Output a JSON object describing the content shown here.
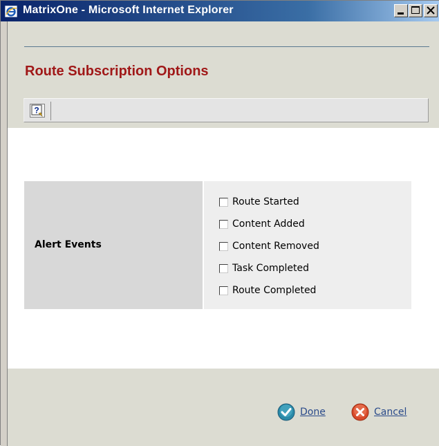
{
  "window": {
    "title": "MatrixOne - Microsoft Internet Explorer"
  },
  "header": {
    "title": "Route Subscription Options"
  },
  "toolbar": {
    "help_icon": "help-icon"
  },
  "form": {
    "label": "Alert Events",
    "options": [
      {
        "label": "Route Started",
        "checked": false
      },
      {
        "label": "Content Added",
        "checked": false
      },
      {
        "label": "Content Removed",
        "checked": false
      },
      {
        "label": "Task Completed",
        "checked": false
      },
      {
        "label": "Route Completed",
        "checked": false
      }
    ]
  },
  "footer": {
    "done_label": "Done",
    "cancel_label": "Cancel"
  },
  "colors": {
    "title_red": "#a01818",
    "link_blue": "#2a4a8a",
    "done_teal": "#2a8aa8",
    "cancel_red": "#d84a2a"
  }
}
